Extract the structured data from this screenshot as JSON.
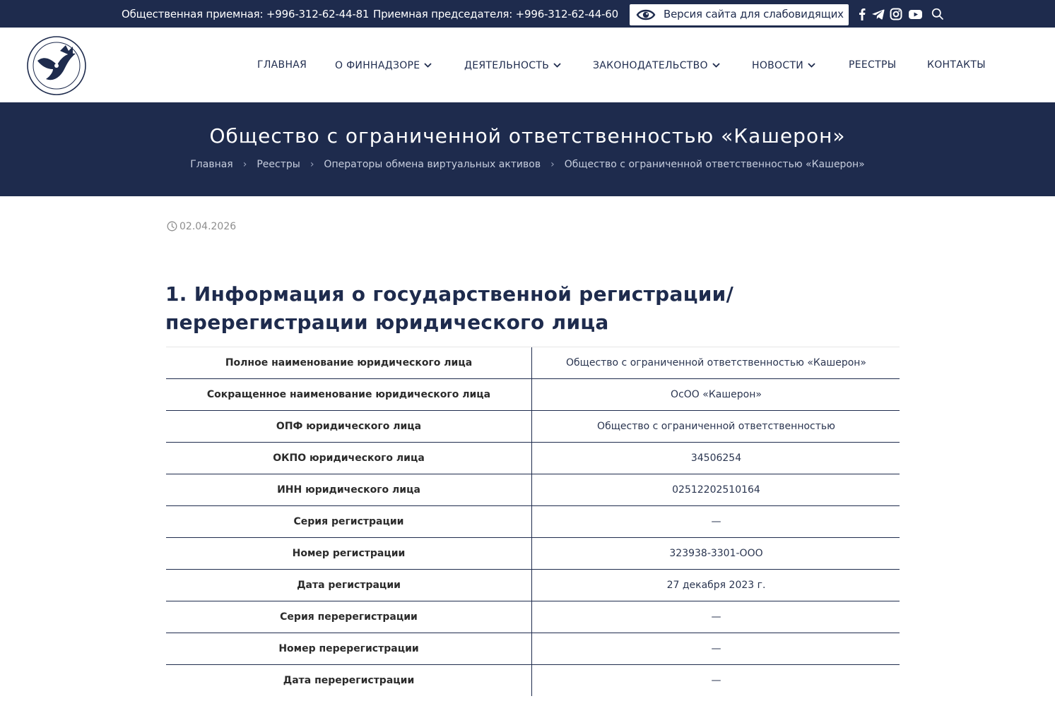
{
  "topbar": {
    "phone_public": "Общественная приемная: +996-312-62-44-81",
    "phone_chair": "Приемная председателя: +996-312-62-44-60",
    "vision_label": "Версия сайта для слабовидящих",
    "icons": [
      "eye-icon",
      "facebook-icon",
      "telegram-icon",
      "instagram-icon",
      "youtube-icon",
      "search-icon"
    ]
  },
  "nav": {
    "items": [
      {
        "label": "ГЛАВНАЯ",
        "dropdown": false
      },
      {
        "label": "О ФИННАДЗОРЕ",
        "dropdown": true
      },
      {
        "label": "ДЕЯТЕЛЬНОСТЬ",
        "dropdown": true
      },
      {
        "label": "ЗАКОНОДАТЕЛЬСТВО",
        "dropdown": true
      },
      {
        "label": "НОВОСТИ",
        "dropdown": true
      },
      {
        "label": "РЕЕСТРЫ",
        "dropdown": false
      },
      {
        "label": "КОНТАКТЫ",
        "dropdown": false
      }
    ]
  },
  "banner": {
    "title": "Общество с ограниченной ответственностью «Кашерон»",
    "breadcrumbs": [
      "Главная",
      "Реестры",
      "Операторы обмена виртуальных активов",
      "Общество с ограниченной ответственностью «Кашерон»"
    ]
  },
  "content": {
    "date": "02.04.2026",
    "section_title": "1. Информация о государственной регистрации/ перерегистрации юридического лица",
    "table": [
      {
        "key": "Полное наименование юридического лица",
        "value": "Общество с ограниченной ответственностью «Кашерон»"
      },
      {
        "key": "Сокращенное наименование юридического лица",
        "value": "ОсОО «Кашерон»"
      },
      {
        "key": "ОПФ юридического лица",
        "value": "Общество с ограниченной ответственностью"
      },
      {
        "key": "ОКПО юридического лица",
        "value": "34506254"
      },
      {
        "key": "ИНН юридического лица",
        "value": "02512202510164"
      },
      {
        "key": "Серия регистрации",
        "value": "—"
      },
      {
        "key": "Номер регистрации",
        "value": "323938-3301-ООО"
      },
      {
        "key": "Дата регистрации",
        "value": "27 декабря 2023 г."
      },
      {
        "key": "Серия перерегистрации",
        "value": "—"
      },
      {
        "key": "Номер перерегистрации",
        "value": "—"
      },
      {
        "key": "Дата перерегистрации",
        "value": "—"
      }
    ]
  },
  "colors": {
    "brand_navy": "#1e2b4d",
    "white": "#ffffff",
    "muted": "#8e8e8e"
  }
}
